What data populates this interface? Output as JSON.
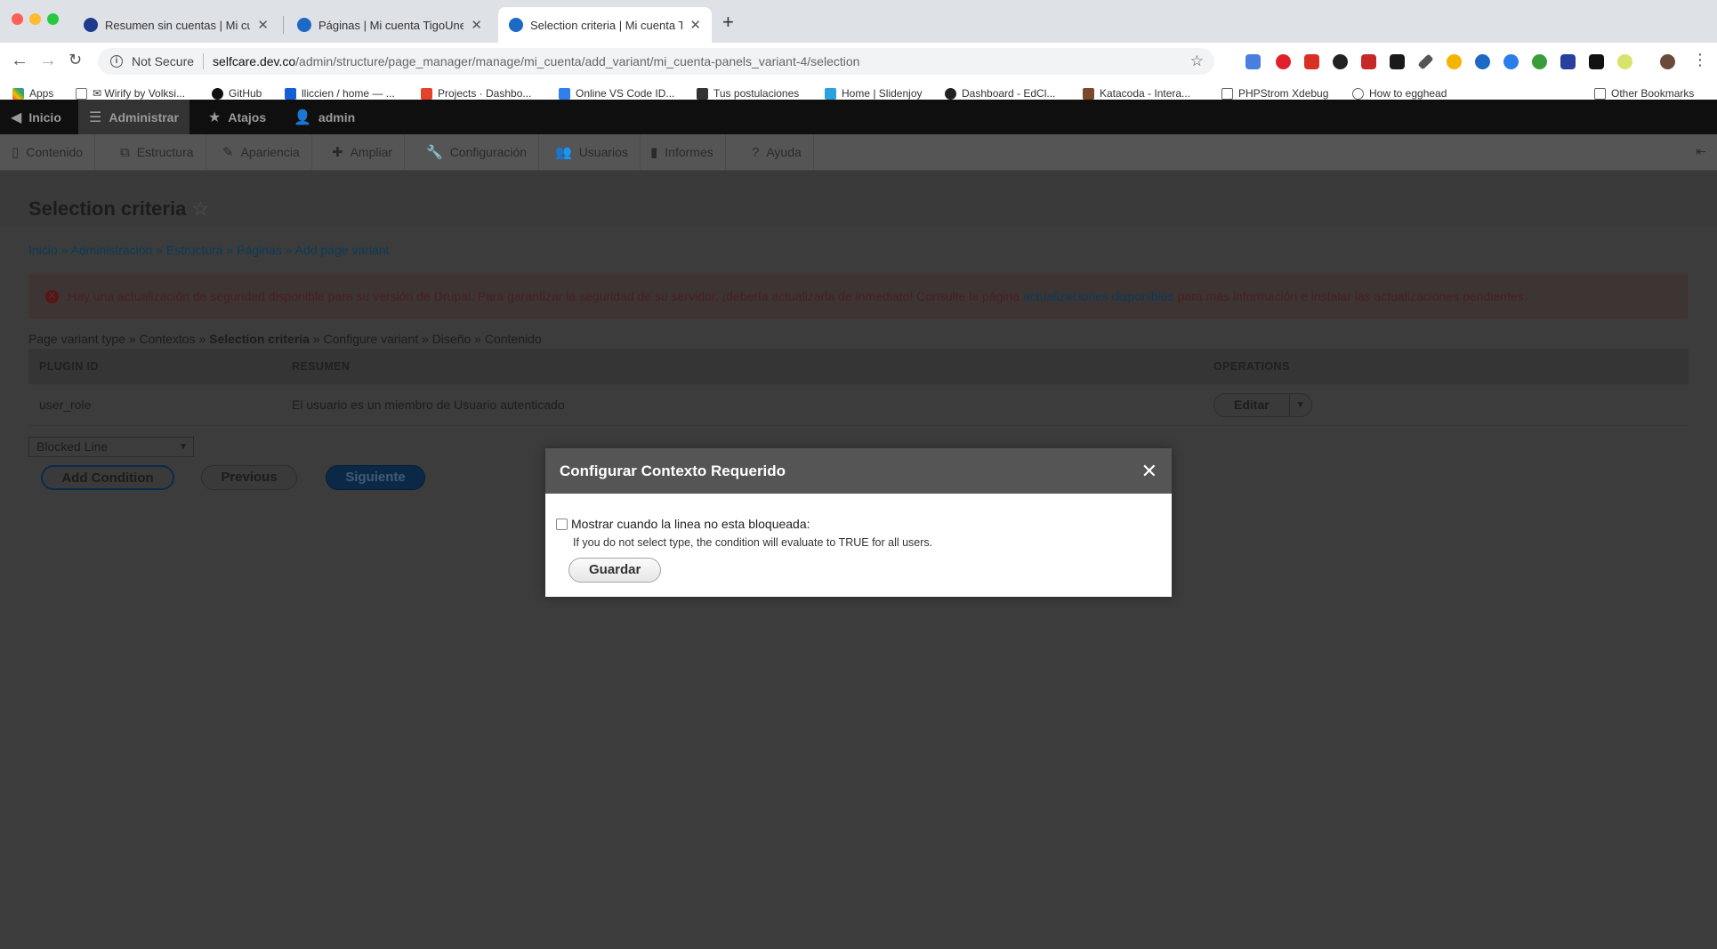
{
  "browser": {
    "tabs": [
      {
        "title": "Resumen sin cuentas | Mi cuenta",
        "active": false
      },
      {
        "title": "Páginas | Mi cuenta TigoUne",
        "active": false
      },
      {
        "title": "Selection criteria | Mi cuenta TigoUne",
        "active": true
      }
    ],
    "address": {
      "security": "Not Secure",
      "host": "selfcare.dev.co",
      "path": "/admin/structure/page_manager/manage/mi_cuenta/add_variant/mi_cuenta-panels_variant-4/selection"
    },
    "bookmarks": [
      "Apps",
      "✉ Wirify by Volksi...",
      "GitHub",
      "lliccien / home — ...",
      "Projects · Dashbo...",
      "Online VS Code ID...",
      "Tus postulaciones",
      "Home | Slidenjoy",
      "Dashboard - EdCl...",
      "Katacoda - Intera...",
      "PHPStrom Xdebug",
      "How to egghead",
      "Other Bookmarks"
    ]
  },
  "drupal_toolbar": {
    "items": [
      "Inicio",
      "Administrar",
      "Atajos",
      "admin"
    ]
  },
  "admin_menu": {
    "items": [
      "Contenido",
      "Estructura",
      "Apariencia",
      "Ampliar",
      "Configuración",
      "Usuarios",
      "Informes",
      "Ayuda"
    ]
  },
  "page": {
    "title": "Selection criteria",
    "breadcrumb": "Inicio » Administración » Estructura » Páginas » Add page variant",
    "alert": {
      "text": "Hay una actualización de seguridad disponible para su versión de Drupal. Para garantizar la seguridad de su servidor, ¡debería actualizarla de inmediato! Consulte la página ",
      "link": "actualizaciones disponibles",
      "text_after": " para más información e instalar las actualizaciones pendientes."
    },
    "wizard_steps": {
      "before": "Page variant type » Contextos » ",
      "current": "Selection criteria",
      "after": " » Configure variant » Diseño » Contenido"
    },
    "table": {
      "headers": [
        "PLUGIN ID",
        "RESUMEN",
        "OPERATIONS"
      ],
      "rows": [
        {
          "plugin_id": "user_role",
          "summary": "El usuario es un miembro de Usuario autenticado",
          "operation": "Editar"
        }
      ]
    },
    "condition_select": "Blocked Line",
    "buttons": {
      "add": "Add Condition",
      "previous": "Previous",
      "next": "Siguiente"
    }
  },
  "modal": {
    "title": "Configurar Contexto Requerido",
    "checkbox_label": "Mostrar cuando la linea no esta bloqueada:",
    "description": "If you do not select type, the condition will evaluate to TRUE for all users.",
    "save": "Guardar"
  }
}
